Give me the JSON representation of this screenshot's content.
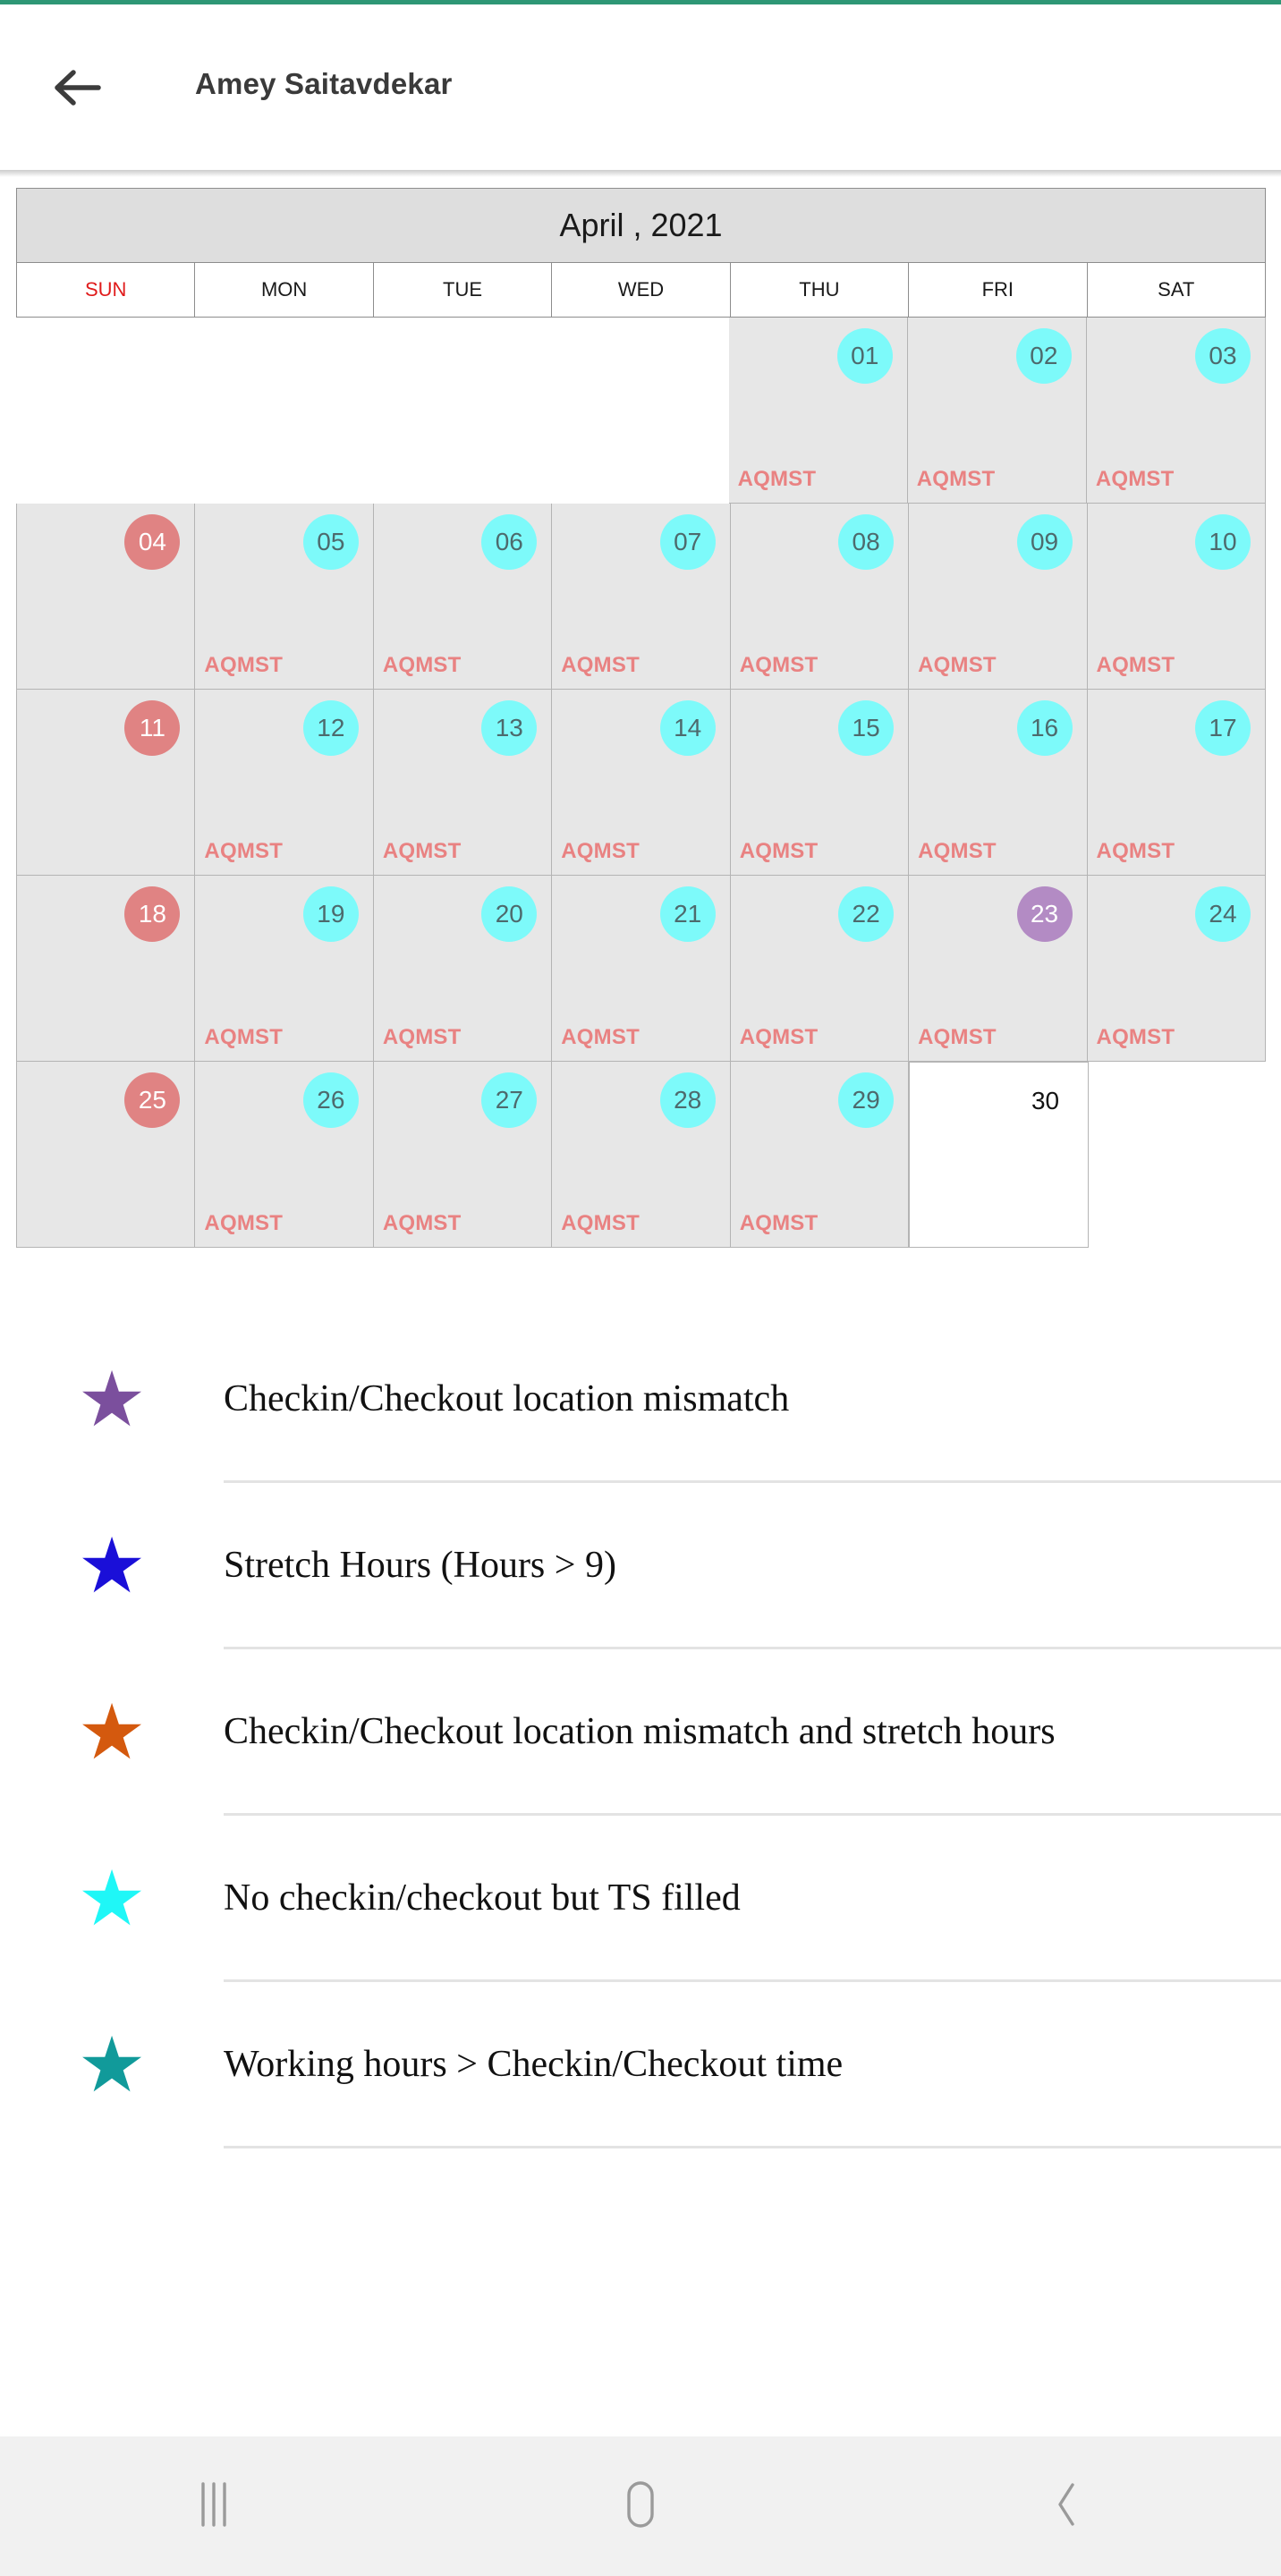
{
  "theme": {
    "accent_line": "#2e9775",
    "cyan": "#7dfafa",
    "pink": "#e08383",
    "purple": "#b38bc4",
    "tag_red": "#e98282",
    "sunday_red": "#e01b1b",
    "cell_gray": "#e7e7e7",
    "month_header_gray": "#dedede"
  },
  "appbar": {
    "back_icon": "arrow-left-icon",
    "title": "Amey Saitavdekar"
  },
  "calendar": {
    "month_label": "April , 2021",
    "day_headers": [
      "SUN",
      "MON",
      "TUE",
      "WED",
      "THU",
      "FRI",
      "SAT"
    ],
    "tag_label": "AQMST",
    "weeks": [
      [
        {
          "day": "",
          "style": "blank",
          "tag": ""
        },
        {
          "day": "",
          "style": "blank",
          "tag": ""
        },
        {
          "day": "",
          "style": "blank",
          "tag": ""
        },
        {
          "day": "",
          "style": "blank",
          "tag": ""
        },
        {
          "day": "01",
          "style": "cyan",
          "tag": "AQMST"
        },
        {
          "day": "02",
          "style": "cyan",
          "tag": "AQMST"
        },
        {
          "day": "03",
          "style": "cyan",
          "tag": "AQMST"
        }
      ],
      [
        {
          "day": "04",
          "style": "pink",
          "tag": ""
        },
        {
          "day": "05",
          "style": "cyan",
          "tag": "AQMST"
        },
        {
          "day": "06",
          "style": "cyan",
          "tag": "AQMST"
        },
        {
          "day": "07",
          "style": "cyan",
          "tag": "AQMST"
        },
        {
          "day": "08",
          "style": "cyan",
          "tag": "AQMST"
        },
        {
          "day": "09",
          "style": "cyan",
          "tag": "AQMST"
        },
        {
          "day": "10",
          "style": "cyan",
          "tag": "AQMST"
        }
      ],
      [
        {
          "day": "11",
          "style": "pink",
          "tag": ""
        },
        {
          "day": "12",
          "style": "cyan",
          "tag": "AQMST"
        },
        {
          "day": "13",
          "style": "cyan",
          "tag": "AQMST"
        },
        {
          "day": "14",
          "style": "cyan",
          "tag": "AQMST"
        },
        {
          "day": "15",
          "style": "cyan",
          "tag": "AQMST"
        },
        {
          "day": "16",
          "style": "cyan",
          "tag": "AQMST"
        },
        {
          "day": "17",
          "style": "cyan",
          "tag": "AQMST"
        }
      ],
      [
        {
          "day": "18",
          "style": "pink",
          "tag": ""
        },
        {
          "day": "19",
          "style": "cyan",
          "tag": "AQMST"
        },
        {
          "day": "20",
          "style": "cyan",
          "tag": "AQMST"
        },
        {
          "day": "21",
          "style": "cyan",
          "tag": "AQMST"
        },
        {
          "day": "22",
          "style": "cyan",
          "tag": "AQMST"
        },
        {
          "day": "23",
          "style": "purple",
          "tag": "AQMST"
        },
        {
          "day": "24",
          "style": "cyan",
          "tag": "AQMST"
        }
      ],
      [
        {
          "day": "25",
          "style": "pink",
          "tag": ""
        },
        {
          "day": "26",
          "style": "cyan",
          "tag": "AQMST"
        },
        {
          "day": "27",
          "style": "cyan",
          "tag": "AQMST"
        },
        {
          "day": "28",
          "style": "cyan",
          "tag": "AQMST"
        },
        {
          "day": "29",
          "style": "cyan",
          "tag": "AQMST"
        },
        {
          "day": "30",
          "style": "plain",
          "tag": ""
        },
        {
          "day": "",
          "style": "blank",
          "tag": ""
        }
      ]
    ]
  },
  "legend": {
    "items": [
      {
        "star_color": "#7b4f9d",
        "label": "Checkin/Checkout location mismatch"
      },
      {
        "star_color": "#1a0fd8",
        "label": "Stretch Hours (Hours > 9)"
      },
      {
        "star_color": "#d4590e",
        "label": "Checkin/Checkout location mismatch and stretch hours"
      },
      {
        "star_color": "#1ff7f7",
        "label": "No checkin/checkout but TS filled"
      },
      {
        "star_color": "#119a9a",
        "label": "Working hours > Checkin/Checkout time"
      }
    ]
  },
  "navbar": {
    "recents_icon": "recents-icon",
    "home_icon": "home-icon",
    "back_icon": "back-chevron-icon"
  }
}
